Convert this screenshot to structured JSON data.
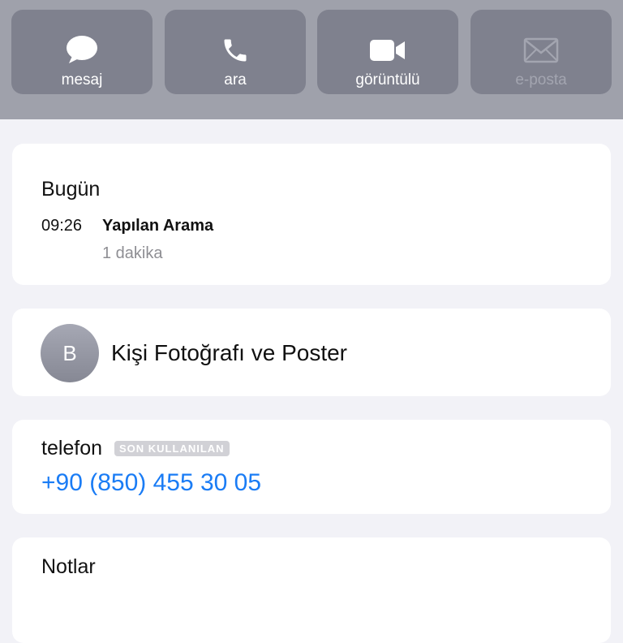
{
  "actions": [
    {
      "label": "mesaj",
      "icon": "message-bubble-icon",
      "enabled": true
    },
    {
      "label": "ara",
      "icon": "phone-icon",
      "enabled": true
    },
    {
      "label": "görüntülü",
      "icon": "video-camera-icon",
      "enabled": true
    },
    {
      "label": "e-posta",
      "icon": "envelope-icon",
      "enabled": false
    }
  ],
  "recents": {
    "day": "Bugün",
    "time": "09:26",
    "type": "Yapılan Arama",
    "duration": "1 dakika"
  },
  "contact_photo": {
    "initial": "B",
    "label": "Kişi Fotoğrafı ve Poster"
  },
  "phone": {
    "label": "telefon",
    "badge": "SON KULLANILAN",
    "number": "+90 (850) 455 30 05"
  },
  "notes": {
    "label": "Notlar"
  },
  "colors": {
    "header_bg": "#9fa1ab",
    "button_bg": "#7f818e",
    "link_blue": "#1a7cf5",
    "page_bg": "#f2f2f7"
  }
}
